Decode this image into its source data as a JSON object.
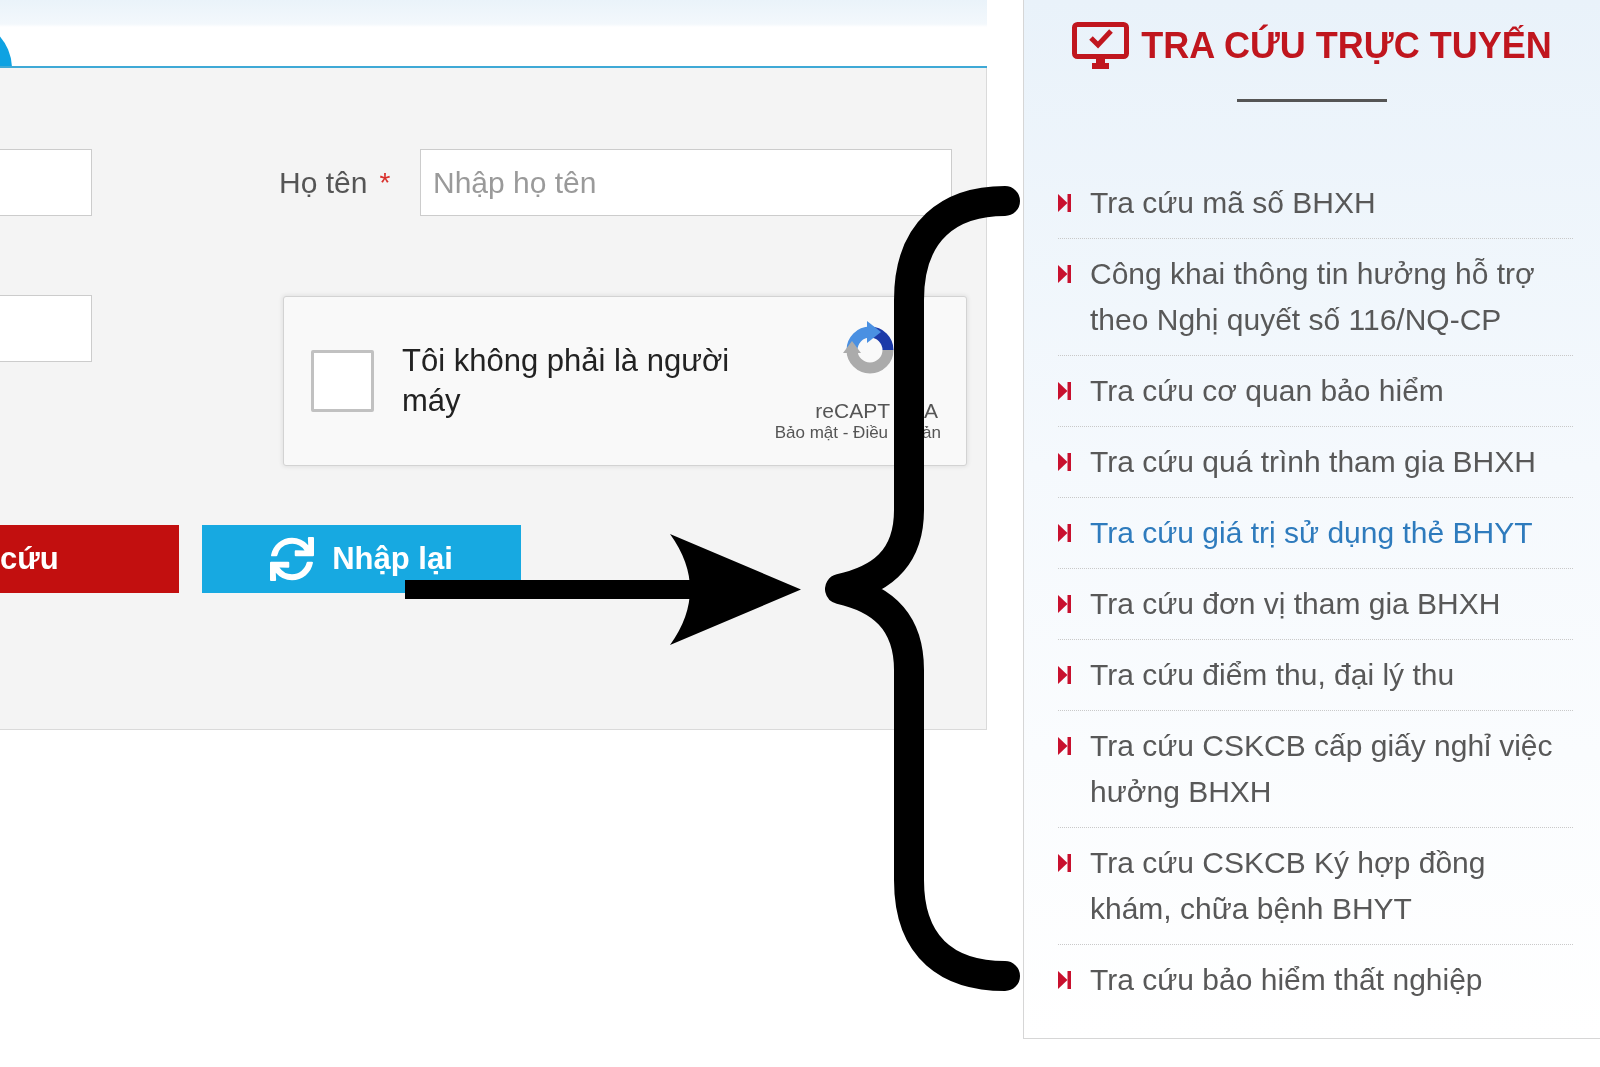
{
  "form": {
    "name_field": {
      "label": "Họ tên",
      "required_mark": "*",
      "placeholder": "Nhập họ tên"
    },
    "captcha": {
      "checked": false,
      "label": "Tôi không phải là người máy",
      "brand_parts": [
        "reCAPT",
        "A"
      ],
      "terms_parts": [
        "Bảo mật - Điều",
        "ản"
      ]
    },
    "buttons": [
      {
        "kind": "submit",
        "label": "cứu"
      },
      {
        "kind": "reset",
        "label": "Nhập lại"
      }
    ]
  },
  "sidebar": {
    "title": "TRA CỨU TRỰC TUYẾN",
    "items": [
      {
        "label": "Tra cứu mã số BHXH",
        "selected": false
      },
      {
        "label": "Công khai thông tin hưởng hỗ trợ theo Nghị quyết số 116/NQ-CP",
        "selected": false
      },
      {
        "label": "Tra cứu cơ quan bảo hiểm",
        "selected": false
      },
      {
        "label": "Tra cứu quá trình tham gia BHXH",
        "selected": false
      },
      {
        "label": "Tra cứu giá trị sử dụng thẻ BHYT",
        "selected": true
      },
      {
        "label": "Tra cứu đơn vị tham gia BHXH",
        "selected": false
      },
      {
        "label": "Tra cứu điểm thu, đại lý thu",
        "selected": false
      },
      {
        "label": "Tra cứu CSKCB cấp giấy nghỉ việc hưởng BHXH",
        "selected": false
      },
      {
        "label": "Tra cứu CSKCB Ký hợp đồng khám, chữa bệnh BHYT",
        "selected": false
      },
      {
        "label": "Tra cứu bảo hiểm thất nghiệp",
        "selected": false
      }
    ]
  }
}
